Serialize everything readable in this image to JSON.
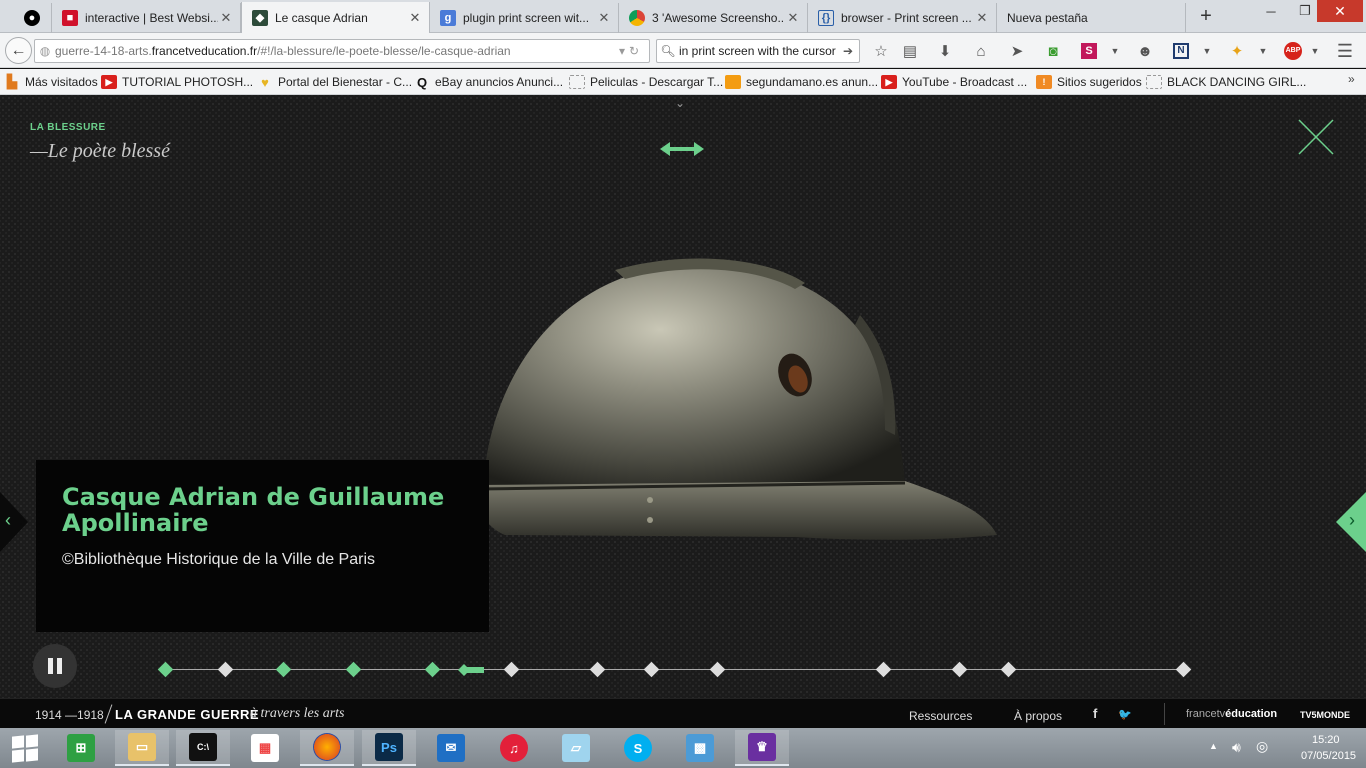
{
  "browser": {
    "tabs": [
      {
        "label": "",
        "icon": "github-icon",
        "color": "#000000"
      },
      {
        "label": "interactive | Best Websi...",
        "icon": "square-icon",
        "color": "#d0112b"
      },
      {
        "label": "Le casque Adrian",
        "icon": "site-icon",
        "color": "#2d4b3a"
      },
      {
        "label": "plugin print screen wit...",
        "icon": "google-icon",
        "color": "#4a7bd8"
      },
      {
        "label": "3 'Awesome Screensho...",
        "icon": "chrome-icon",
        "color": "#e8b81a"
      },
      {
        "label": "browser - Print screen ...",
        "icon": "stackexchange-icon",
        "color": "#2a5fa8"
      },
      {
        "label": "Nueva pestaña",
        "icon": "",
        "color": ""
      }
    ],
    "window": {
      "minimize": "─",
      "maximize": "❐",
      "close": "✕"
    },
    "new_tab": "+",
    "url": {
      "prefix": "guerre-14-18-arts.",
      "host": "francetveducation.fr",
      "path": "/#!/la-blessure/le-poete-blesse/le-casque-adrian"
    },
    "search": {
      "value": "in print screen with the cursor"
    },
    "bookmarks": [
      {
        "label": "Más visitados",
        "icon": "bookmark-icon",
        "color": "#e07a1e"
      },
      {
        "label": "TUTORIAL PHOTOSH...",
        "icon": "youtube-icon",
        "color": "#d9201c"
      },
      {
        "label": "Portal del Bienestar - C...",
        "icon": "heart-icon",
        "color": "#e7b524"
      },
      {
        "label": "eBay anuncios Anunci...",
        "icon": "q-icon",
        "color": "#111111"
      },
      {
        "label": "Peliculas - Descargar T...",
        "icon": "page-icon",
        "color": "#bbbbbb"
      },
      {
        "label": "segundamano.es anun...",
        "icon": "box-icon",
        "color": "#f39c12"
      },
      {
        "label": "YouTube - Broadcast ...",
        "icon": "youtube-icon",
        "color": "#d9201c"
      },
      {
        "label": "Sitios sugeridos",
        "icon": "suggest-icon",
        "color": "#f08a24"
      },
      {
        "label": "BLACK DANCING GIRL...",
        "icon": "page-icon",
        "color": "#bbbbbb"
      }
    ],
    "bookmarks_more": "»"
  },
  "page": {
    "section_label": "LA BLESSURE",
    "section_subtitle": "—Le poète blessé",
    "caption_title": "Casque Adrian de Guillaume Apollinaire",
    "caption_credit": "©Bibliothèque Historique de la Ville de Paris",
    "accent": "#6cd08c",
    "timeline": {
      "count": 14,
      "visited": [
        true,
        false,
        true,
        true,
        true,
        false,
        false,
        false,
        false,
        false,
        false,
        false,
        false,
        false
      ],
      "current_after_index": 4
    }
  },
  "footer": {
    "years": "1914 —1918",
    "brand": "LA GRANDE GUERRE",
    "brand_sub": "à travers les arts",
    "links": [
      "Ressources",
      "À propos"
    ],
    "social": [
      "f",
      "🐦"
    ],
    "partner1_light": "francetv",
    "partner1_bold": "éducation",
    "partner2": "TV5MONDE"
  },
  "taskbar": {
    "time": "15:20",
    "date": "07/05/2015",
    "apps": [
      "store-icon",
      "explorer-icon",
      "cmd-icon",
      "apps-icon",
      "firefox-icon",
      "photoshop-icon",
      "mail-icon",
      "itunes-icon",
      "notepad-icon",
      "skype-icon",
      "photos-icon",
      "trophy-icon"
    ]
  }
}
